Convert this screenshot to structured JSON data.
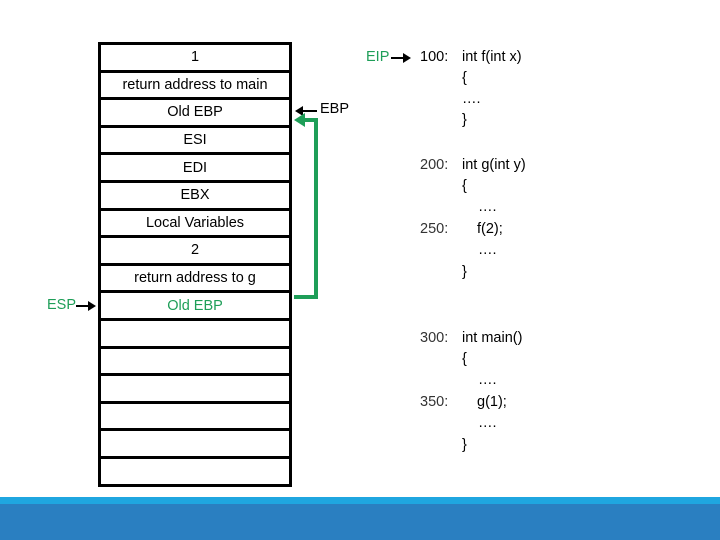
{
  "stack": {
    "rows": [
      {
        "text": "1",
        "highlight": false
      },
      {
        "text": "return address to main",
        "highlight": false
      },
      {
        "text": "Old EBP",
        "highlight": false
      },
      {
        "text": "ESI",
        "highlight": false
      },
      {
        "text": "EDI",
        "highlight": false
      },
      {
        "text": "EBX",
        "highlight": false
      },
      {
        "text": "Local Variables",
        "highlight": false
      },
      {
        "text": "2",
        "highlight": false
      },
      {
        "text": "return address to g",
        "highlight": false
      },
      {
        "text": "Old EBP",
        "highlight": true
      },
      {
        "text": "",
        "highlight": false
      },
      {
        "text": "",
        "highlight": false
      },
      {
        "text": "",
        "highlight": false
      },
      {
        "text": "",
        "highlight": false
      },
      {
        "text": "",
        "highlight": false
      },
      {
        "text": "",
        "highlight": false
      }
    ]
  },
  "pointers": {
    "esp": "ESP",
    "ebp": "EBP",
    "eip": "EIP"
  },
  "code": {
    "f": {
      "addr": "100:",
      "lines": [
        "int f(int x)",
        "{",
        "….",
        "}"
      ]
    },
    "g": {
      "addr": "200:",
      "call_addr": "250:",
      "lines": [
        "int g(int y)",
        "{",
        "….",
        "f(2);",
        "….",
        "}"
      ]
    },
    "main": {
      "addr": "300:",
      "call_addr": "350:",
      "lines": [
        "int main()",
        "{",
        "….",
        "g(1);",
        "….",
        "}"
      ]
    }
  },
  "colors": {
    "highlight_green": "#1e9e58",
    "bar_light": "#1fa6e0",
    "bar_dark": "#2a7fc1"
  }
}
